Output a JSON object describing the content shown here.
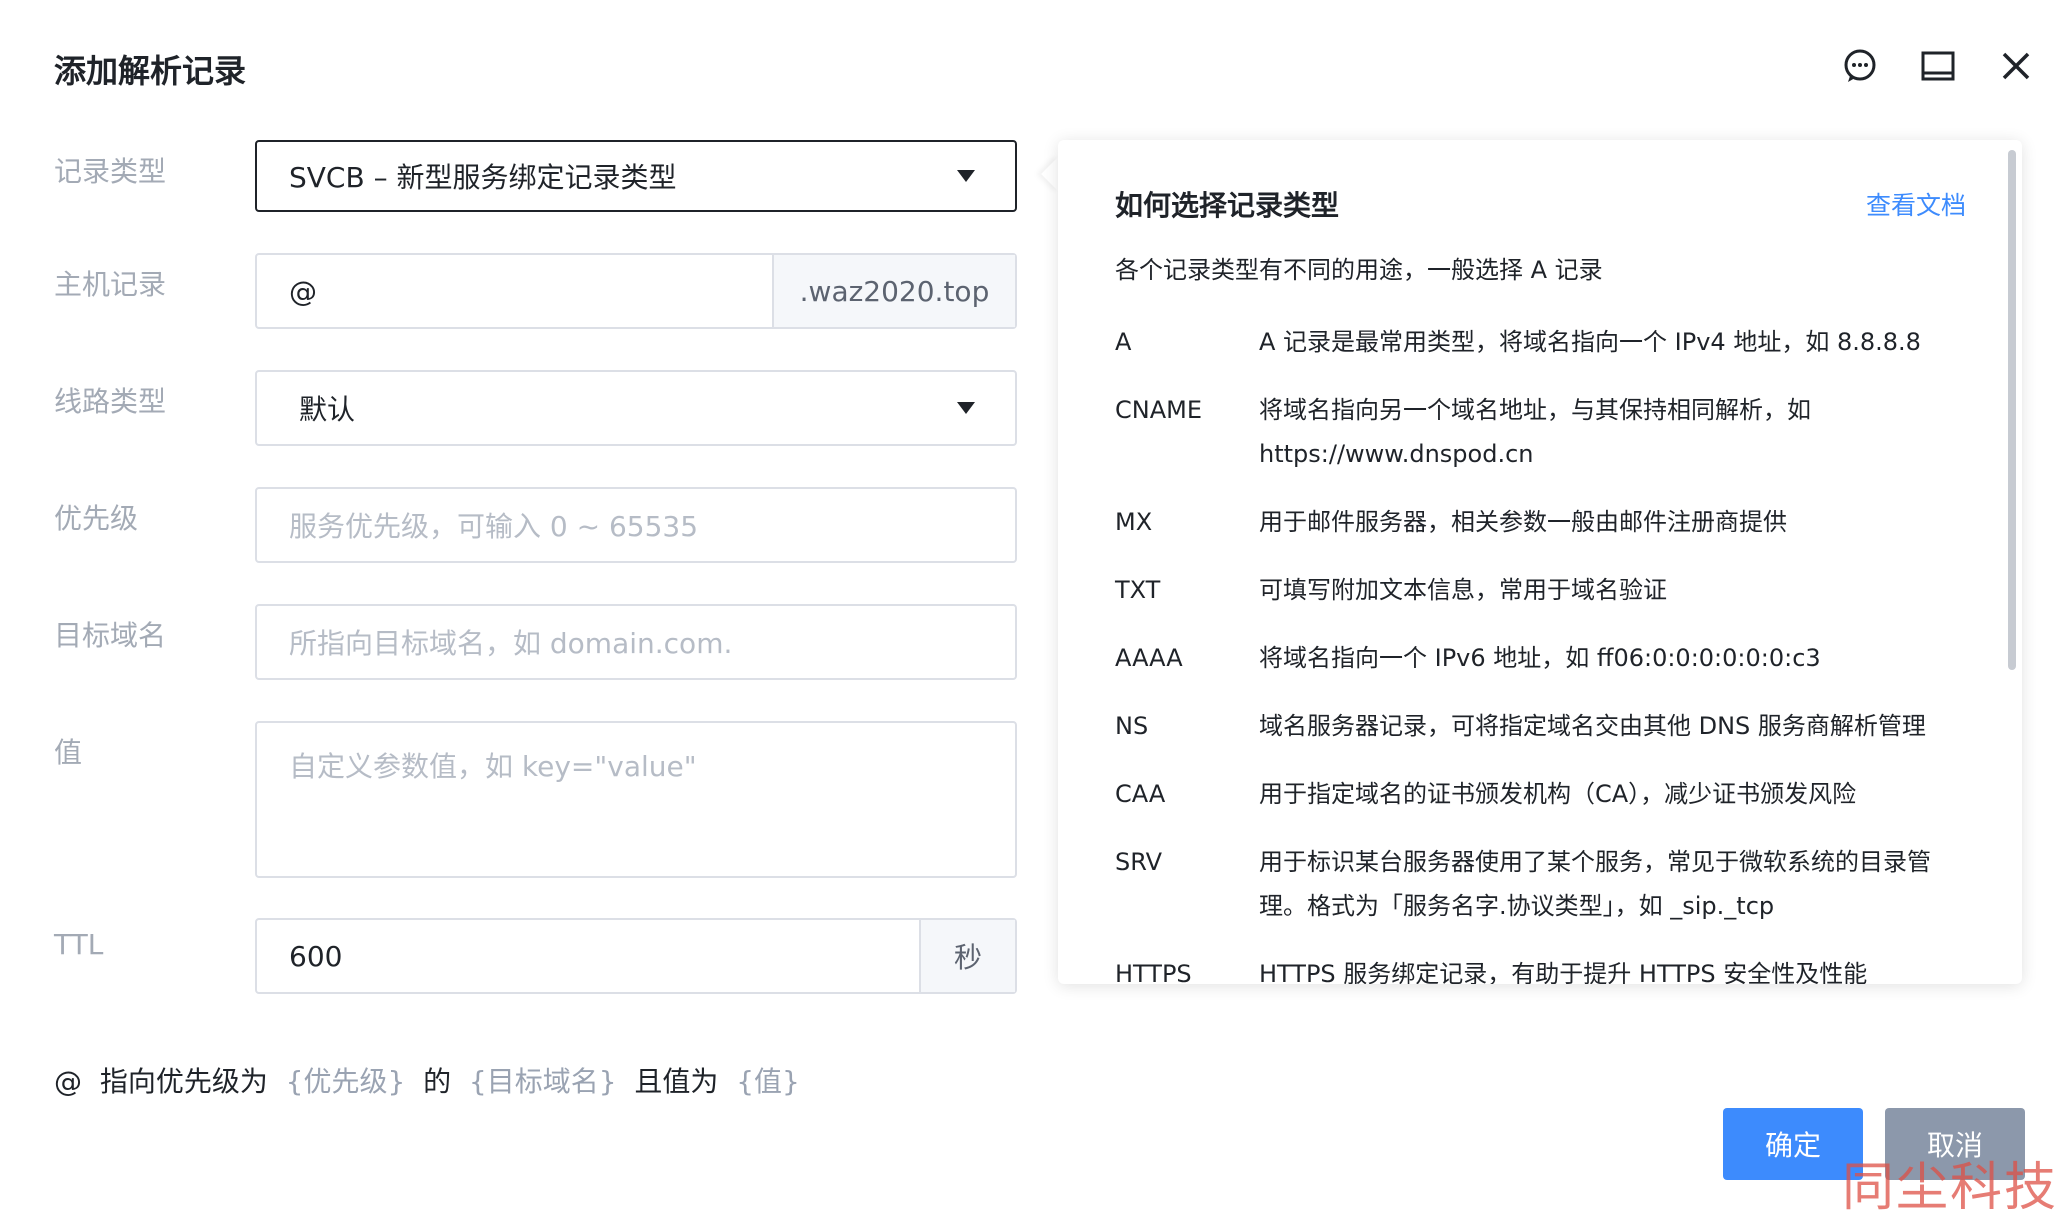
{
  "dialog": {
    "title": "添加解析记录",
    "icons": [
      "chat-icon",
      "window-icon",
      "close-icon"
    ]
  },
  "form": {
    "record_type": {
      "label": "记录类型",
      "value": "SVCB – 新型服务绑定记录类型"
    },
    "host": {
      "label": "主机记录",
      "value": "@",
      "suffix": ".waz2020.top"
    },
    "line_type": {
      "label": "线路类型",
      "value": "默认"
    },
    "priority": {
      "label": "优先级",
      "placeholder": "服务优先级，可输入 0 ~ 65535"
    },
    "target": {
      "label": "目标域名",
      "placeholder": "所指向目标域名，如 domain.com."
    },
    "value": {
      "label": "值",
      "placeholder": "自定义参数值，如 key=\"value\""
    },
    "ttl": {
      "label": "TTL",
      "value": "600",
      "unit": "秒"
    }
  },
  "summary": {
    "prefix": "@",
    "t1": "指向优先级为",
    "p1": "{优先级}",
    "t2": "的",
    "p2": "{目标域名}",
    "t3": "且值为",
    "p3": "{值}"
  },
  "buttons": {
    "ok": "确定",
    "cancel": "取消"
  },
  "help": {
    "title": "如何选择记录类型",
    "link": "查看文档",
    "desc": "各个记录类型有不同的用途，一般选择 A 记录",
    "records": [
      {
        "type": "A",
        "desc": "A 记录是最常用类型，将域名指向一个 IPv4 地址，如 8.8.8.8"
      },
      {
        "type": "CNAME",
        "desc": "将域名指向另一个域名地址，与其保持相同解析，如 https://www.dnspod.cn"
      },
      {
        "type": "MX",
        "desc": "用于邮件服务器，相关参数一般由邮件注册商提供"
      },
      {
        "type": "TXT",
        "desc": "可填写附加文本信息，常用于域名验证"
      },
      {
        "type": "AAAA",
        "desc": "将域名指向一个 IPv6 地址，如 ff06:0:0:0:0:0:0:c3"
      },
      {
        "type": "NS",
        "desc": "域名服务器记录，可将指定域名交由其他 DNS 服务商解析管理"
      },
      {
        "type": "CAA",
        "desc": "用于指定域名的证书颁发机构（CA），减少证书颁发风险"
      },
      {
        "type": "SRV",
        "desc": "用于标识某台服务器使用了某个服务，常见于微软系统的目录管理。格式为「服务名字.协议类型」，如 _sip._tcp"
      },
      {
        "type": "HTTPS",
        "desc": "HTTPS 服务绑定记录，有助于提升 HTTPS 安全性及性能"
      }
    ]
  },
  "watermark": "同尘科技"
}
